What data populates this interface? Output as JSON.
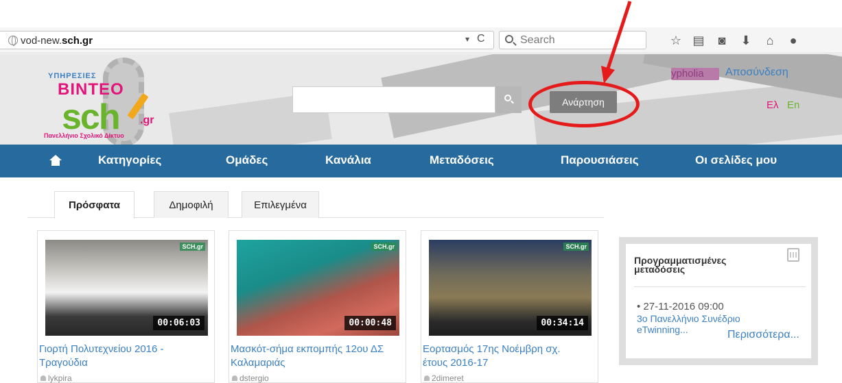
{
  "browser": {
    "url_prefix": "vod-new.",
    "url_domain": "sch.gr",
    "dropdown_glyph": "▾",
    "reload_glyph": "C",
    "search_placeholder": "Search",
    "toolbar_icons": [
      "star-icon",
      "reading-list-icon",
      "pocket-icon",
      "download-icon",
      "home-icon",
      "chat-icon"
    ]
  },
  "header": {
    "logo": {
      "line1": "ΥΠΗΡΕΣΙΕΣ",
      "line2": "ΒΙΝΤΕΟ",
      "line3": "sch",
      "line4": ".gr",
      "line5": "Πανελλήνιο Σχολικό Δίκτυο"
    },
    "search_value": "",
    "upload_label": "Ανάρτηση",
    "user_name": "ypholia",
    "logout_label": "Αποσύνδεση",
    "lang_el": "Ελ",
    "lang_en": "En"
  },
  "nav": {
    "items": [
      "Κατηγορίες",
      "Ομάδες",
      "Κανάλια",
      "Μεταδόσεις",
      "Παρουσιάσεις",
      "Οι σελίδες μου"
    ]
  },
  "tabs": [
    {
      "label": "Πρόσφατα",
      "active": true
    },
    {
      "label": "Δημοφιλή",
      "active": false
    },
    {
      "label": "Επιλεγμένα",
      "active": false
    }
  ],
  "videos": [
    {
      "title": "Γιορτή Πολυτεχνείου 2016 - Τραγούδια",
      "duration": "00:06:03",
      "user": "lykpira",
      "watermark": "SCH.gr"
    },
    {
      "title": "Μασκότ-σήμα εκπομπής 12ου ΔΣ Καλαμαριάς",
      "duration": "00:00:48",
      "user": "dstergio",
      "watermark": "SCH.gr"
    },
    {
      "title": "Εορτασμός 17ης Νοέμβρη σχ. έτους 2016-17",
      "duration": "00:34:14",
      "user": "2dimeret",
      "watermark": "SCH.gr"
    }
  ],
  "sidebar": {
    "title": "Προγραμματισμένες μεταδόσεις",
    "date": "• 27-11-2016 09:00",
    "event": "3ο Πανελλήνιο Συνέδριο eTwinning...",
    "more": "Περισσότερα..."
  },
  "colors": {
    "nav_bg": "#276b9e",
    "link": "#3a7fc2",
    "annotation": "#e51b1b",
    "brand_pink": "#e2147a",
    "brand_green": "#6ab42d"
  }
}
